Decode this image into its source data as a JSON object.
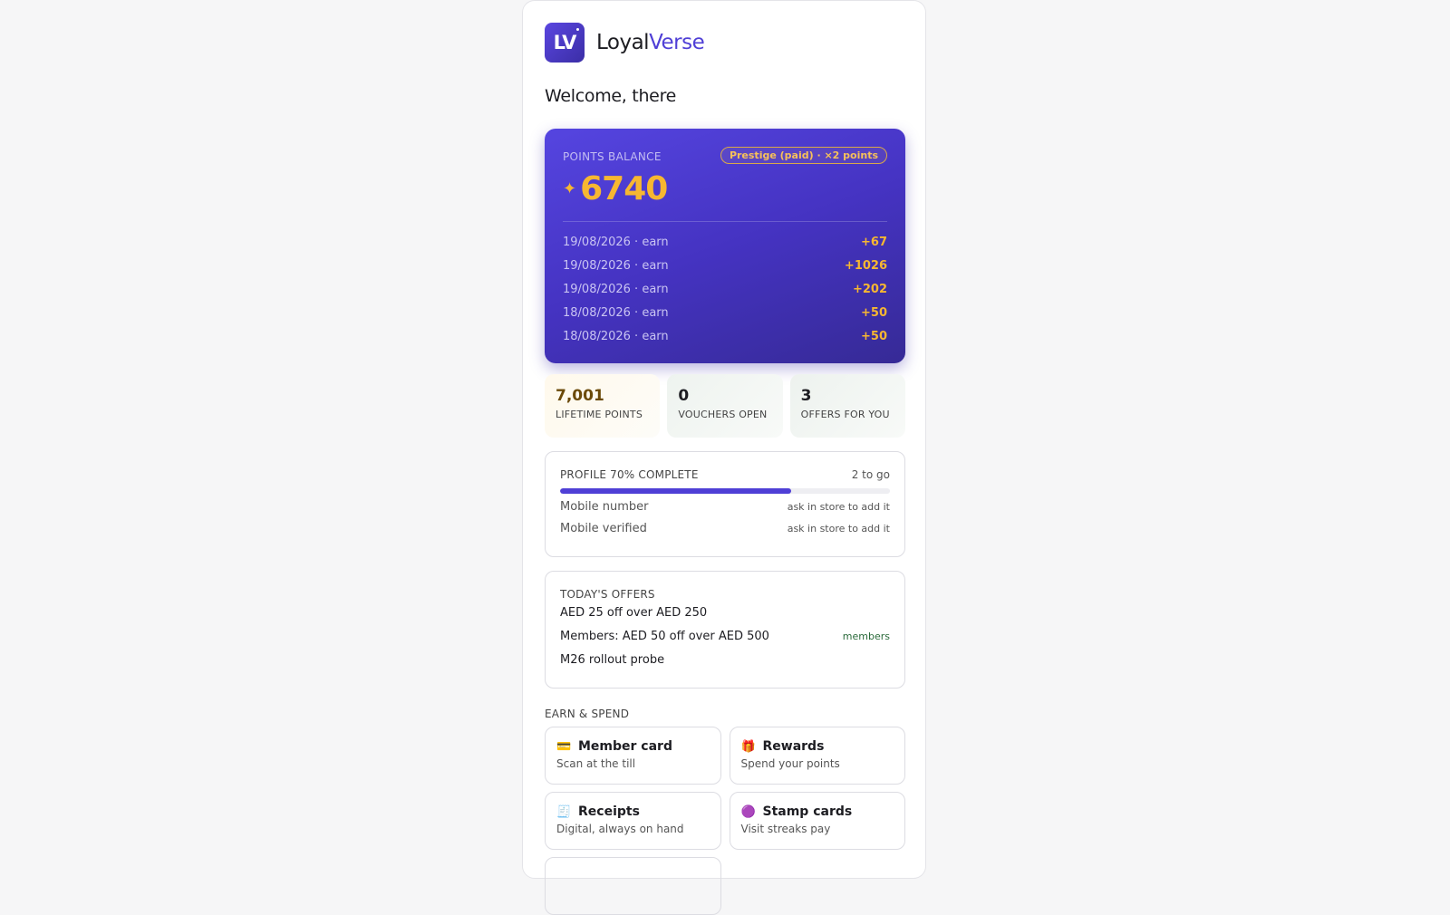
{
  "brand": {
    "logo_text": "LV",
    "name_part1": "Loyal",
    "name_part2": "Verse"
  },
  "welcome": "Welcome, there",
  "balance": {
    "label": "POINTS BALANCE",
    "tier": "Prestige (paid) · ×2 points",
    "star": "✦",
    "value": "6740",
    "transactions": [
      {
        "desc": "19/08/2026 · earn",
        "amount": "+67"
      },
      {
        "desc": "19/08/2026 · earn",
        "amount": "+1026"
      },
      {
        "desc": "19/08/2026 · earn",
        "amount": "+202"
      },
      {
        "desc": "18/08/2026 · earn",
        "amount": "+50"
      },
      {
        "desc": "18/08/2026 · earn",
        "amount": "+50"
      }
    ]
  },
  "stats": [
    {
      "value": "7,001",
      "label": "LIFETIME POINTS"
    },
    {
      "value": "0",
      "label": "VOUCHERS OPEN"
    },
    {
      "value": "3",
      "label": "OFFERS FOR YOU"
    }
  ],
  "profile": {
    "title": "PROFILE 70% COMPLETE",
    "remaining": "2 to go",
    "progress_percent": 70,
    "rows": [
      {
        "field": "Mobile number",
        "hint": "ask in store to add it"
      },
      {
        "field": "Mobile verified",
        "hint": "ask in store to add it"
      }
    ]
  },
  "offers": {
    "title": "TODAY'S OFFERS",
    "items": [
      {
        "text": "AED 25 off over AED 250",
        "tag": ""
      },
      {
        "text": "Members: AED 50 off over AED 500",
        "tag": "members"
      },
      {
        "text": "M26 rollout probe",
        "tag": ""
      }
    ]
  },
  "earn_spend": {
    "label": "EARN & SPEND",
    "tiles": [
      {
        "icon": "card-icon",
        "glyph": "💳",
        "title": "Member card",
        "subtitle": "Scan at the till"
      },
      {
        "icon": "gift-icon",
        "glyph": "🎁",
        "title": "Rewards",
        "subtitle": "Spend your points"
      },
      {
        "icon": "receipt-icon",
        "glyph": "🧾",
        "title": "Receipts",
        "subtitle": "Digital, always on hand"
      },
      {
        "icon": "stamp-icon",
        "glyph": "🟣",
        "title": "Stamp cards",
        "subtitle": "Visit streaks pay"
      }
    ]
  }
}
